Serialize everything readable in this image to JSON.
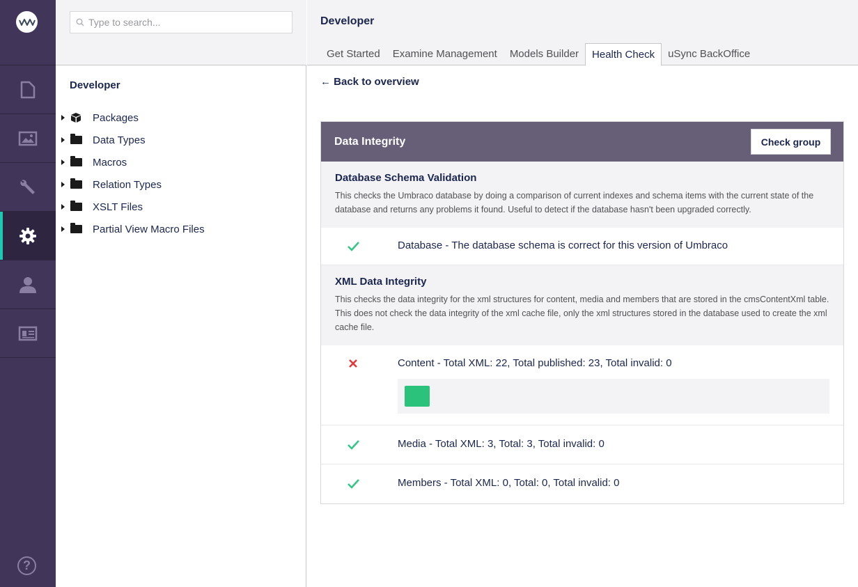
{
  "rail": {
    "items": [
      {
        "name": "content",
        "icon": "document-icon"
      },
      {
        "name": "media",
        "icon": "image-icon"
      },
      {
        "name": "settings",
        "icon": "wrench-icon"
      },
      {
        "name": "developer",
        "icon": "gear-icon",
        "active": true
      },
      {
        "name": "users",
        "icon": "user-icon"
      },
      {
        "name": "members",
        "icon": "id-card-icon"
      }
    ],
    "help_label": "?",
    "accent_color": "#1dc9b3"
  },
  "tree": {
    "search_placeholder": "Type to search...",
    "title": "Developer",
    "items": [
      {
        "label": "Packages",
        "icon": "package-icon"
      },
      {
        "label": "Data Types",
        "icon": "folder-icon"
      },
      {
        "label": "Macros",
        "icon": "folder-icon"
      },
      {
        "label": "Relation Types",
        "icon": "folder-icon"
      },
      {
        "label": "XSLT Files",
        "icon": "folder-icon"
      },
      {
        "label": "Partial View Macro Files",
        "icon": "folder-icon"
      }
    ]
  },
  "main": {
    "title": "Developer",
    "tabs": [
      {
        "label": "Get Started"
      },
      {
        "label": "Examine Management"
      },
      {
        "label": "Models Builder"
      },
      {
        "label": "Health Check",
        "active": true
      },
      {
        "label": "uSync BackOffice"
      }
    ],
    "back_label": "← Back to overview",
    "group": {
      "title": "Data Integrity",
      "button_label": "Check group",
      "header_color": "#675e78",
      "checks": [
        {
          "name": "Database Schema Validation",
          "description": "This checks the Umbraco database by doing a comparison of current indexes and schema items with the current state of the database and returns any problems it found. Useful to detect if the database hasn't been upgraded correctly.",
          "results": [
            {
              "status": "success",
              "text": "Database - The database schema is correct for this version of Umbraco"
            }
          ]
        },
        {
          "name": "XML Data Integrity",
          "description": "This checks the data integrity for the xml structures for content, media and members that are stored in the cmsContentXml table. This does not check the data integrity of the xml cache file, only the xml structures stored in the database used to create the xml cache file.",
          "results": [
            {
              "status": "error",
              "text": "Content - Total XML: 22, Total published: 23, Total invalid: 0",
              "has_action": true
            },
            {
              "status": "success",
              "text": "Media - Total XML: 3, Total: 3, Total invalid: 0"
            },
            {
              "status": "success",
              "text": "Members - Total XML: 0, Total: 0, Total invalid: 0"
            }
          ]
        }
      ]
    }
  },
  "colors": {
    "success": "#35c786",
    "error": "#d42054",
    "action_button": "#2bc37c"
  }
}
